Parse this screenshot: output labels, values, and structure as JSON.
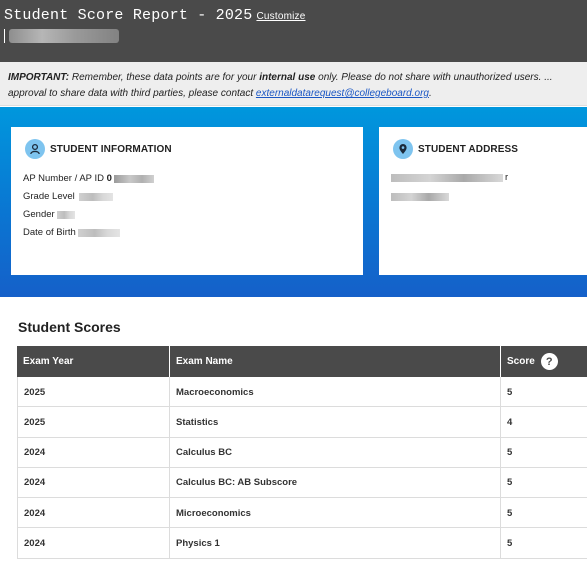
{
  "header": {
    "title": "Student Score Report - 2025",
    "customize_label": "Customize"
  },
  "notice": {
    "important_label": "IMPORTANT:",
    "text_before_bold": " Remember, these data points are for your ",
    "bold_text": "internal use",
    "text_after_bold": " only. Please do not share with unauthorized users. ...",
    "line2_text": "approval to share data with third parties, please contact ",
    "email": "externaldatarequest@collegeboard.org",
    "line2_end": "."
  },
  "student_information": {
    "title": "STUDENT INFORMATION",
    "icon": "person-icon",
    "fields": [
      {
        "label": "AP Number / AP ID",
        "visible_value": "0"
      },
      {
        "label": "Grade Level",
        "visible_value": ""
      },
      {
        "label": "Gender",
        "visible_value": ""
      },
      {
        "label": "Date of Birth",
        "visible_value": ""
      }
    ]
  },
  "student_address": {
    "title": "STUDENT ADDRESS",
    "icon": "location-pin-icon",
    "visible_fragment": "r"
  },
  "scores": {
    "title": "Student Scores",
    "columns": [
      "Exam Year",
      "Exam Name",
      "Score"
    ],
    "help_icon": "?",
    "rows": [
      {
        "year": "2025",
        "exam": "Macroeconomics",
        "score": "5"
      },
      {
        "year": "2025",
        "exam": "Statistics",
        "score": "4"
      },
      {
        "year": "2024",
        "exam": "Calculus BC",
        "score": "5"
      },
      {
        "year": "2024",
        "exam": "Calculus BC: AB Subscore",
        "score": "5"
      },
      {
        "year": "2024",
        "exam": "Microeconomics",
        "score": "5"
      },
      {
        "year": "2024",
        "exam": "Physics 1",
        "score": "5"
      }
    ]
  },
  "colors": {
    "header_bg": "#4a4a4a",
    "band_top": "#0097dd",
    "band_bottom": "#1560c9",
    "icon_circle": "#7ec4ef",
    "link": "#1a56c4"
  }
}
